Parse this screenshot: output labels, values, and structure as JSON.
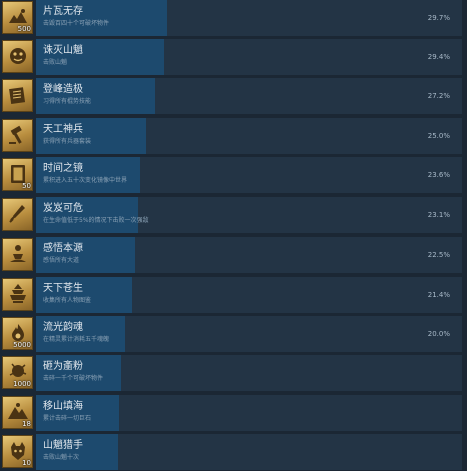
{
  "achievements": [
    {
      "name": "片瓦无存",
      "desc": "击毁百四十个可破坏物件",
      "percent": "29.7%",
      "fill_fraction": 0.297,
      "badge": "500",
      "icon": "rubble-icon"
    },
    {
      "name": "诛灭山魈",
      "desc": "击败山魈",
      "percent": "29.4%",
      "fill_fraction": 0.294,
      "badge": "",
      "icon": "demon-face-icon"
    },
    {
      "name": "登峰造极",
      "desc": "习得所有棍势技能",
      "percent": "27.2%",
      "fill_fraction": 0.272,
      "badge": "",
      "icon": "scroll-book-icon"
    },
    {
      "name": "天工神兵",
      "desc": "获得所有兵器套装",
      "percent": "25.0%",
      "fill_fraction": 0.25,
      "badge": "",
      "icon": "forge-hammer-icon"
    },
    {
      "name": "时间之镜",
      "desc": "累积进入五十次变化镜像中世界",
      "percent": "23.6%",
      "fill_fraction": 0.236,
      "badge": "50",
      "icon": "mirror-icon"
    },
    {
      "name": "岌岌可危",
      "desc": "在生命值低于5%的情况下击败一次强敌",
      "percent": "23.1%",
      "fill_fraction": 0.231,
      "badge": "",
      "icon": "dagger-icon"
    },
    {
      "name": "感悟本源",
      "desc": "感悟所有大道",
      "percent": "22.5%",
      "fill_fraction": 0.225,
      "badge": "",
      "icon": "meditation-icon"
    },
    {
      "name": "天下苍生",
      "desc": "收集所有人物图鉴",
      "percent": "21.4%",
      "fill_fraction": 0.214,
      "badge": "",
      "icon": "pagoda-icon"
    },
    {
      "name": "流光韵魂",
      "desc": "在精灵累计消耗五千魂魄",
      "percent": "20.0%",
      "fill_fraction": 0.2,
      "badge": "5000",
      "icon": "soul-flame-icon"
    },
    {
      "name": "砸为齑粉",
      "desc": "击碎一千个可破坏物件",
      "percent": "",
      "fill_fraction": 0.185,
      "badge": "1000",
      "icon": "smash-icon"
    },
    {
      "name": "移山填海",
      "desc": "累计击碎一切巨石",
      "percent": "",
      "fill_fraction": 0.182,
      "badge": "18",
      "icon": "mountain-icon"
    },
    {
      "name": "山魈猎手",
      "desc": "击败山魈十次",
      "percent": "",
      "fill_fraction": 0.18,
      "badge": "10",
      "icon": "hunter-head-icon"
    }
  ]
}
